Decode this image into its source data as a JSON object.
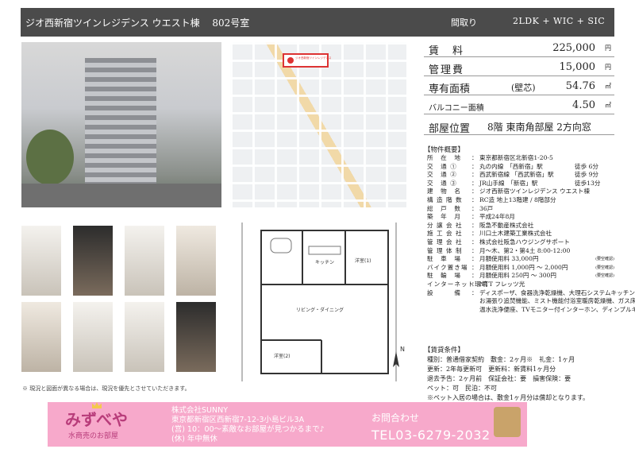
{
  "header": {
    "title": "ジオ西新宿ツインレジデンス ウエスト棟　 802号室",
    "madori_label": "間取り",
    "madori_value": "2LDK + WIC + SIC"
  },
  "price": {
    "rent_label": "賃　料",
    "rent_value": "225,000",
    "rent_unit": "円",
    "fee_label": "管理費",
    "fee_value": "15,000",
    "fee_unit": "円",
    "area_label": "専有面積",
    "area_note": "(壁芯)",
    "area_value": "54.76",
    "area_unit": "㎡",
    "balcony_label": "バルコニー面積",
    "balcony_value": "4.50",
    "balcony_unit": "㎡",
    "position_label": "部屋位置",
    "position_value": "8階 東南角部屋 2方向窓"
  },
  "gaiyo": {
    "title": "【物件概要】",
    "rows": [
      {
        "k": "所　在　地",
        "v": "東京都新宿区北新宿1-20-5",
        "w": ""
      },
      {
        "k": "交　通 ①",
        "v": "丸の内線　「西新宿」駅",
        "w": "徒歩 6分"
      },
      {
        "k": "交　通 ②",
        "v": "西武新宿線 「西武新宿」駅",
        "w": "徒歩 9分"
      },
      {
        "k": "交　通 ③",
        "v": "JR山手線　「新宿」駅",
        "w": "徒歩13分"
      },
      {
        "k": "建　物　名",
        "v": "ジオ西新宿ツインレジデンス ウエスト棟",
        "w": ""
      },
      {
        "k": "構 造 階 数",
        "v": "RC造 地上13階建 / 8階部分",
        "w": ""
      },
      {
        "k": "総　戸　数",
        "v": "36戸",
        "w": ""
      },
      {
        "k": "築　年　月",
        "v": "平成24年8月",
        "w": ""
      },
      {
        "k": "分 譲 会 社",
        "v": "阪急不動産株式会社",
        "w": ""
      },
      {
        "k": "施 工 会 社",
        "v": "川口土木建築工業株式会社",
        "w": ""
      },
      {
        "k": "管 理 会 社",
        "v": "株式会社阪急ハウジングサポート",
        "w": ""
      },
      {
        "k": "管 理 体 制",
        "v": "月～木、第2・第4土 8:00-12:00",
        "w": ""
      },
      {
        "k": "駐　車　場",
        "v": "月額使用料 33,000円",
        "w": "",
        "n": "(要空確認)"
      },
      {
        "k": "バイク置き場",
        "v": "月額使用料 1,000円 ～ 2,000円",
        "w": "",
        "n": "(要空確認)"
      },
      {
        "k": "駐　輪　場",
        "v": "月額使用料 250円 ～ 300円",
        "w": "",
        "n": "(要空確認)"
      },
      {
        "k": "インターネット環境",
        "v": "NTT フレッツ光",
        "w": ""
      },
      {
        "k": "設　　　備",
        "v": "ディスポーザ、食器洗浄乾燥機、大理石システムキッチン",
        "w": ""
      },
      {
        "k": "",
        "v": "お湯張り追焚機能、ミスト機能付浴室暖房乾燥機、ガス床暖房",
        "w": ""
      },
      {
        "k": "",
        "v": "温水洗浄便座、TVモニター付インターホン、ディンプルキー",
        "w": ""
      }
    ]
  },
  "joken": {
    "title": "【賃貸条件】",
    "lines": [
      "種別：普通借家契約　敷金：2ヶ月※　礼金：1ヶ月",
      "更新：2年毎更新可　更新料：新賃料1ヶ月分",
      "退去予告：2ヶ月前　保証会社：要　損害保険：要",
      "ペット：可　民泊：不可",
      "※ペット入居の場合は、敷金1ヶ月分は償却となります。"
    ]
  },
  "left_note": "※ 現況と図面が異なる場合は、現況を優先とさせていただきます。",
  "map": {
    "pin_label": "ジオ西新宿ツインレジデンス"
  },
  "floorplan": {
    "kitchen": "キッチン",
    "yoshitsu1": "洋室(1)",
    "living": "リビング・ダイニング",
    "yoshitsu2": "洋室(2)",
    "compass": "N"
  },
  "banner": {
    "logo": "みずべや",
    "logo_sub": "水商売のお部屋",
    "company": "株式会社SUNNY",
    "address": "東京都新宿区西新宿7-12-3小島ビル3A",
    "hours": "(営) 10：00～素敵なお部屋が見つかるまで♪",
    "holiday": "(休) 年中無休",
    "contact": "お問合わせ",
    "tel": "TEL03-6279-2032"
  }
}
